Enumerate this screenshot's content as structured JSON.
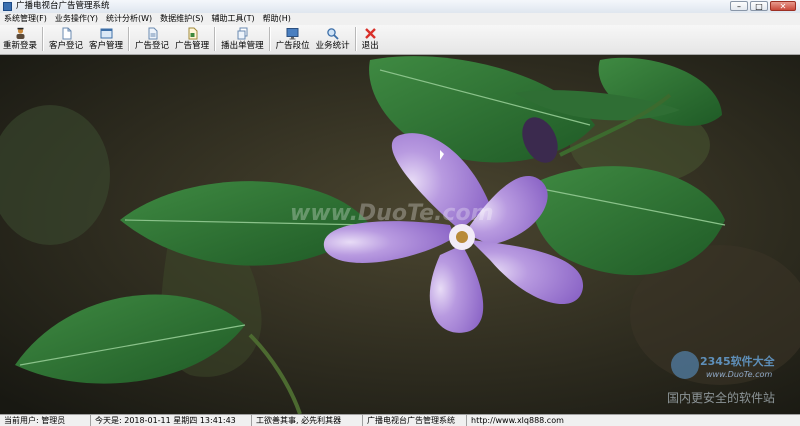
{
  "window": {
    "title": "广播电视台广告管理系统"
  },
  "menu": {
    "items": [
      "系统管理(F)",
      "业务操作(Y)",
      "统计分析(W)",
      "数据维护(S)",
      "辅助工具(T)",
      "帮助(H)"
    ]
  },
  "toolbar": {
    "relogin": "重新登录",
    "customer_register": "客户登记",
    "customer_manage": "客户管理",
    "ad_register": "广告登记",
    "ad_manage": "广告管理",
    "broadcast_manage": "播出单管理",
    "ad_slot": "广告段位",
    "business_stats": "业务统计",
    "exit": "退出"
  },
  "status": {
    "current_user": "当前用户: 管理员",
    "today": "今天是: 2018-01-11 星期四 13:41:43",
    "motto": "工欲善其事, 必先利其器",
    "system_name": "广播电视台广告管理系统",
    "url": "http://www.xlq888.com"
  },
  "watermarks": {
    "center": "www.DuoTe.com",
    "brand": "2345软件大全",
    "brand_url": "www.DuoTe.com",
    "slogan": "国内更安全的软件站"
  },
  "icons": {
    "relogin": "user-icon",
    "customer_register": "document-icon",
    "customer_manage": "window-icon",
    "ad_register": "document-icon",
    "ad_manage": "document-icon",
    "broadcast_manage": "copy-icon",
    "ad_slot": "monitor-icon",
    "business_stats": "magnifier-icon",
    "exit": "close-x-icon"
  }
}
